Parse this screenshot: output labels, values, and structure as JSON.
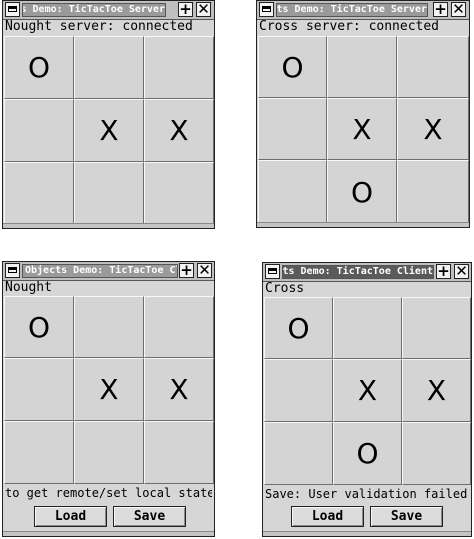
{
  "windows": [
    {
      "title": "Objects Demo: TicTacToe Server",
      "status": "Nought server: connected",
      "board": [
        "O",
        "",
        "",
        "",
        "X",
        "X",
        "",
        "",
        ""
      ]
    },
    {
      "title": "Objects Demo: TicTacToe Server",
      "status": "Cross server: connected",
      "board": [
        "O",
        "",
        "",
        "",
        "X",
        "X",
        "",
        "O",
        ""
      ]
    },
    {
      "title": "Objects Demo: TicTacToe Client",
      "status": "Nought",
      "board": [
        "O",
        "",
        "",
        "",
        "X",
        "X",
        "",
        "",
        ""
      ],
      "message": "to get remote/set local state.",
      "load_label": "Load",
      "save_label": "Save"
    },
    {
      "title": "Objects Demo: TicTacToe Client",
      "status": "Cross",
      "board": [
        "O",
        "",
        "",
        "",
        "X",
        "X",
        "",
        "O",
        ""
      ],
      "message": "Save: User validation failed.",
      "load_label": "Load",
      "save_label": "Save"
    }
  ],
  "icons": {
    "menu": "window-menu-icon",
    "maximize": "plus-icon",
    "close": "close-icon"
  },
  "icon_glyphs": {
    "plus": "+",
    "close": "✕"
  }
}
